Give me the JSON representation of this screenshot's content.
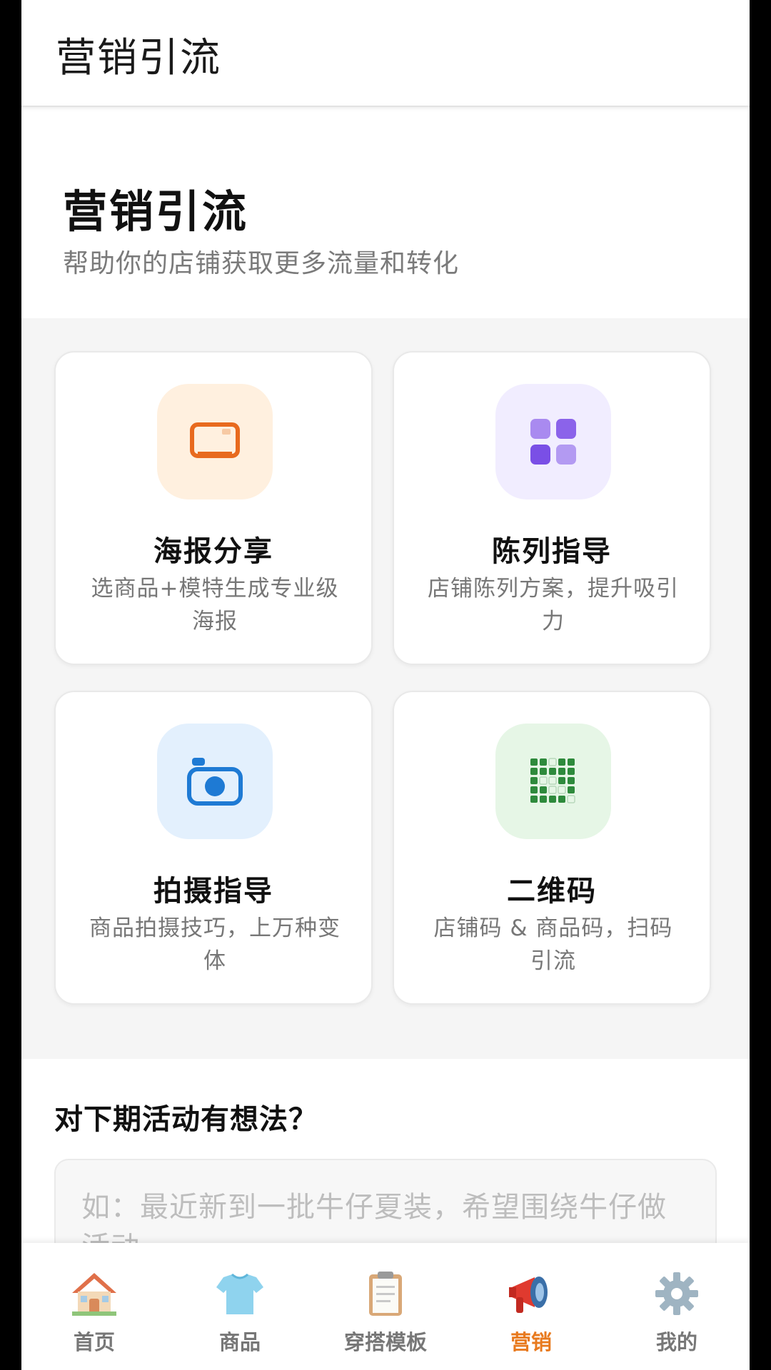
{
  "header": {
    "title": "营销引流"
  },
  "hero": {
    "title": "营销引流",
    "subtitle": "帮助你的店铺获取更多流量和转化"
  },
  "cards": [
    {
      "title": "海报分享",
      "desc": "选商品+模特生成专业级海报",
      "icon": "poster-icon",
      "color": "#e86a1e",
      "bg": "#fff0df"
    },
    {
      "title": "陈列指导",
      "desc": "店铺陈列方案，提升吸引力",
      "icon": "grid-icon",
      "color": "#7a52e0",
      "bg": "#f1edff"
    },
    {
      "title": "拍摄指导",
      "desc": "商品拍摄技巧，上万种变体",
      "icon": "camera-icon",
      "color": "#1e7ad4",
      "bg": "#e3f0fd"
    },
    {
      "title": "二维码",
      "desc": "店铺码 & 商品码，扫码引流",
      "icon": "qrcode-icon",
      "color": "#2e8a3c",
      "bg": "#e6f6e6"
    }
  ],
  "feedback": {
    "title": "对下期活动有想法？",
    "placeholder": "如：最近新到一批牛仔夏装，希望围绕牛仔做活动..."
  },
  "nav": {
    "active_color": "#e87a1e",
    "items": [
      {
        "label": "首页",
        "icon": "house-icon",
        "active": false
      },
      {
        "label": "商品",
        "icon": "tshirt-icon",
        "active": false
      },
      {
        "label": "穿搭模板",
        "icon": "clipboard-icon",
        "active": false
      },
      {
        "label": "营销",
        "icon": "megaphone-icon",
        "active": true
      },
      {
        "label": "我的",
        "icon": "gear-icon",
        "active": false
      }
    ]
  }
}
